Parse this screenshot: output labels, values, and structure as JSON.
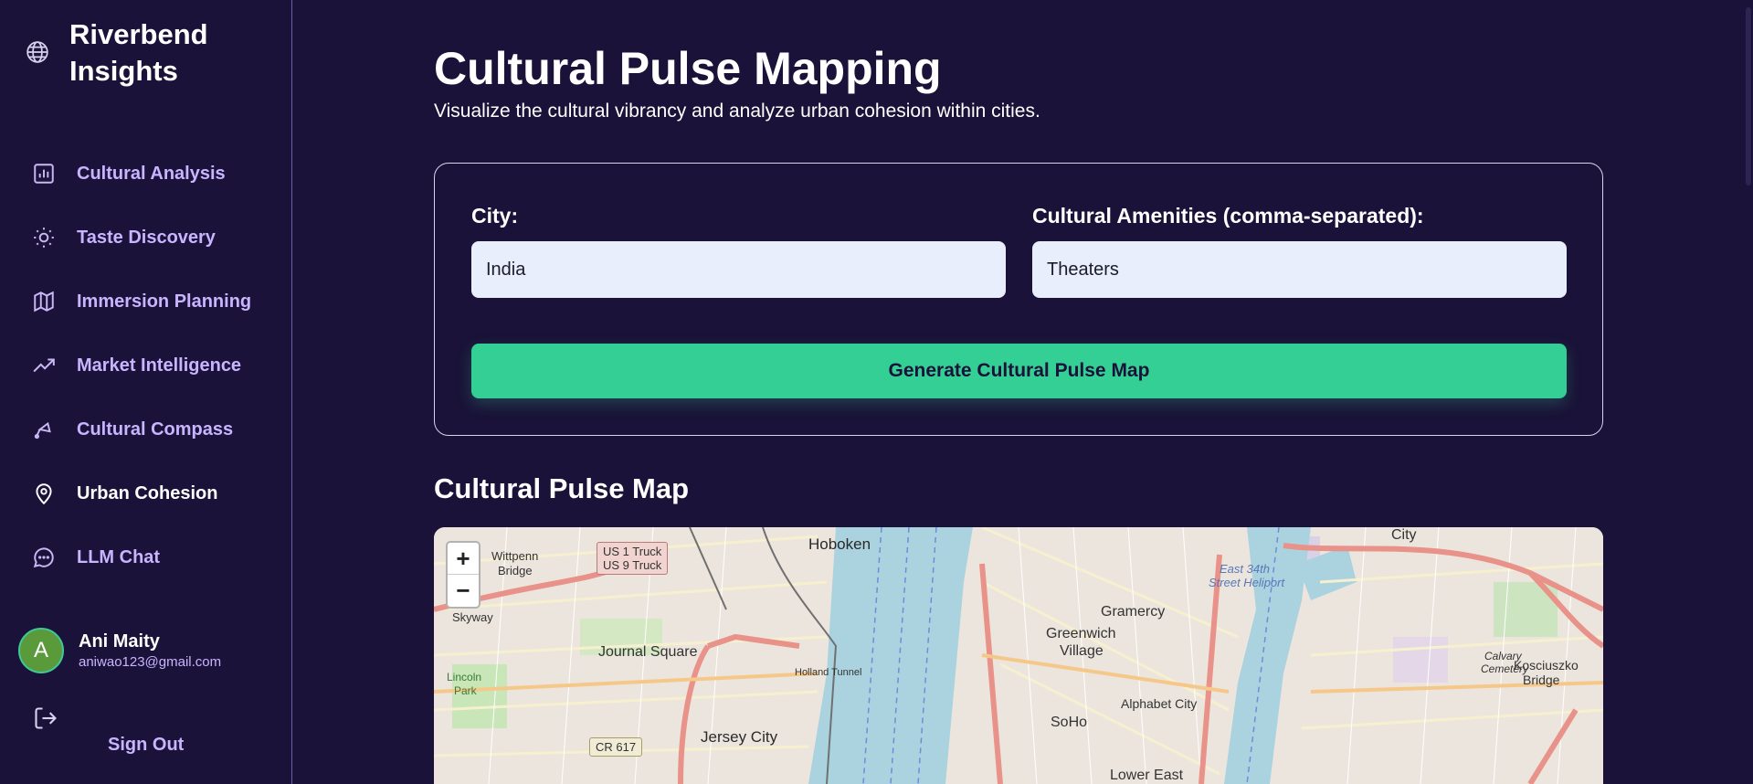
{
  "brand": {
    "title": "Riverbend Insights",
    "icon": "globe-icon"
  },
  "nav": {
    "items": [
      {
        "label": "Cultural Analysis",
        "icon": "bar-chart-icon",
        "active": false
      },
      {
        "label": "Taste Discovery",
        "icon": "lightbulb-icon",
        "active": false
      },
      {
        "label": "Immersion Planning",
        "icon": "map-icon",
        "active": false
      },
      {
        "label": "Market Intelligence",
        "icon": "trending-up-icon",
        "active": false
      },
      {
        "label": "Cultural Compass",
        "icon": "compass-icon",
        "active": false
      },
      {
        "label": "Urban Cohesion",
        "icon": "map-pin-icon",
        "active": true
      },
      {
        "label": "LLM Chat",
        "icon": "chat-bubble-icon",
        "active": false
      }
    ]
  },
  "user": {
    "initial": "A",
    "name": "Ani Maity",
    "email": "aniwao123@gmail.com",
    "signout_label": "Sign Out"
  },
  "page": {
    "title": "Cultural Pulse Mapping",
    "subtitle": "Visualize the cultural vibrancy and analyze urban cohesion within cities."
  },
  "form": {
    "city_label": "City:",
    "city_value": "India",
    "amenities_label": "Cultural Amenities (comma-separated):",
    "amenities_value": "Theaters",
    "generate_label": "Generate Cultural Pulse Map"
  },
  "map": {
    "section_title": "Cultural Pulse Map",
    "zoom_in": "+",
    "zoom_out": "−",
    "labels": {
      "hoboken": "Hoboken",
      "journal_square": "Journal Square",
      "jersey_city": "Jersey City",
      "greenwich": "Greenwich",
      "village": "Village",
      "gramercy": "Gramercy",
      "soho": "SoHo",
      "alphabet_city": "Alphabet City",
      "lower_east": "Lower East",
      "kosciuszko": "Kosciuszko",
      "bridge": "Bridge",
      "wittpenn": "Wittpenn",
      "wittpenn_bridge": "Bridge",
      "skyway": "Skyway",
      "city": "City",
      "lincoln": "Lincoln",
      "park": "Park",
      "holland_tunnel": "Holland Tunnel",
      "heliport": "Street Heliport",
      "east34": "East 34th",
      "calvary": "Calvary",
      "cemetery": "Cemetery"
    },
    "shields": {
      "us1": "US 1 Truck",
      "us9": "US 9 Truck",
      "cr617": "CR 617"
    }
  },
  "colors": {
    "background": "#1a1238",
    "accent": "#34cf94",
    "nav_text": "#c9b4ff",
    "input_bg": "#e8eefb"
  }
}
